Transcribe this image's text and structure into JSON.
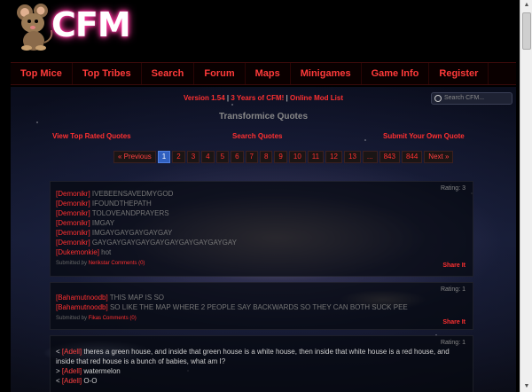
{
  "header": {
    "logo_text": "CFM"
  },
  "nav": {
    "items": [
      "Top Mice",
      "Top Tribes",
      "Search",
      "Forum",
      "Maps",
      "Minigames",
      "Game Info",
      "Register"
    ]
  },
  "top": {
    "version": "Version 1.54",
    "years": "3 Years of CFM!",
    "online": "Online Mod List",
    "separator": "|",
    "search_placeholder": "Search CFM..."
  },
  "page": {
    "title": "Transformice Quotes",
    "links": {
      "top_rated": "View Top Rated Quotes",
      "search": "Search Quotes",
      "submit": "Submit Your Own Quote"
    }
  },
  "pager": {
    "prev": "« Previous",
    "pages": [
      "1",
      "2",
      "3",
      "4",
      "5",
      "6",
      "7",
      "8",
      "9",
      "10",
      "11",
      "12",
      "13",
      "...",
      "843",
      "844"
    ],
    "current": "1",
    "next": "Next »"
  },
  "quotes": [
    {
      "rating": "Rating: 3",
      "lines": [
        {
          "name": "[Demonikr]",
          "text": "IVEBEENSAVEDMYGOD"
        },
        {
          "name": "[Demonikr]",
          "text": "IFOUNDTHEPATH"
        },
        {
          "name": "[Demonikr]",
          "text": "TOLOVEANDPRAYERS"
        },
        {
          "name": "[Demonikr]",
          "text": "IMGAY"
        },
        {
          "name": "[Demonikr]",
          "text": "IMGAYGAYGAYGAYGAY"
        },
        {
          "name": "[Demonikr]",
          "text": "GAYGAYGAYGAYGAYGAYGAYGAYGAYGAY"
        },
        {
          "name": "[Dukemonkie]",
          "text": "hot"
        }
      ],
      "submitted_prefix": "Submitted by",
      "submitted_by": "Nerikstar",
      "comments": "Comments (0)",
      "share": "Share It"
    },
    {
      "rating": "Rating: 1",
      "lines": [
        {
          "name": "[Bahamutnoodb]",
          "text": "THIS MAP IS SO"
        },
        {
          "name": "[Bahamutnoodb]",
          "text": "SO LIKE THE MAP WHERE 2 PEOPLE SAY BACKWARDS SO THEY CAN BOTH SUCK PEE"
        }
      ],
      "submitted_prefix": "Submitted by",
      "submitted_by": "Fikas",
      "comments": "Comments (0)",
      "share": "Share It"
    },
    {
      "rating": "Rating: 1",
      "lines": [
        {
          "prefix": "< ",
          "name": "[Adell]",
          "text": " theres a green house, and inside that green house is a white house, then inside that white house is a red house, and inside that red house is a bunch of babies, what am I?"
        },
        {
          "prefix": "> ",
          "name": "[Adell]",
          "text": " watermelon"
        },
        {
          "prefix": "< ",
          "name": "[Adell]",
          "text": " O-O"
        }
      ]
    }
  ],
  "colors": {
    "accent": "#ff3030",
    "pager_current": "#3060c0",
    "logo_glow": "#ff3aa0"
  }
}
